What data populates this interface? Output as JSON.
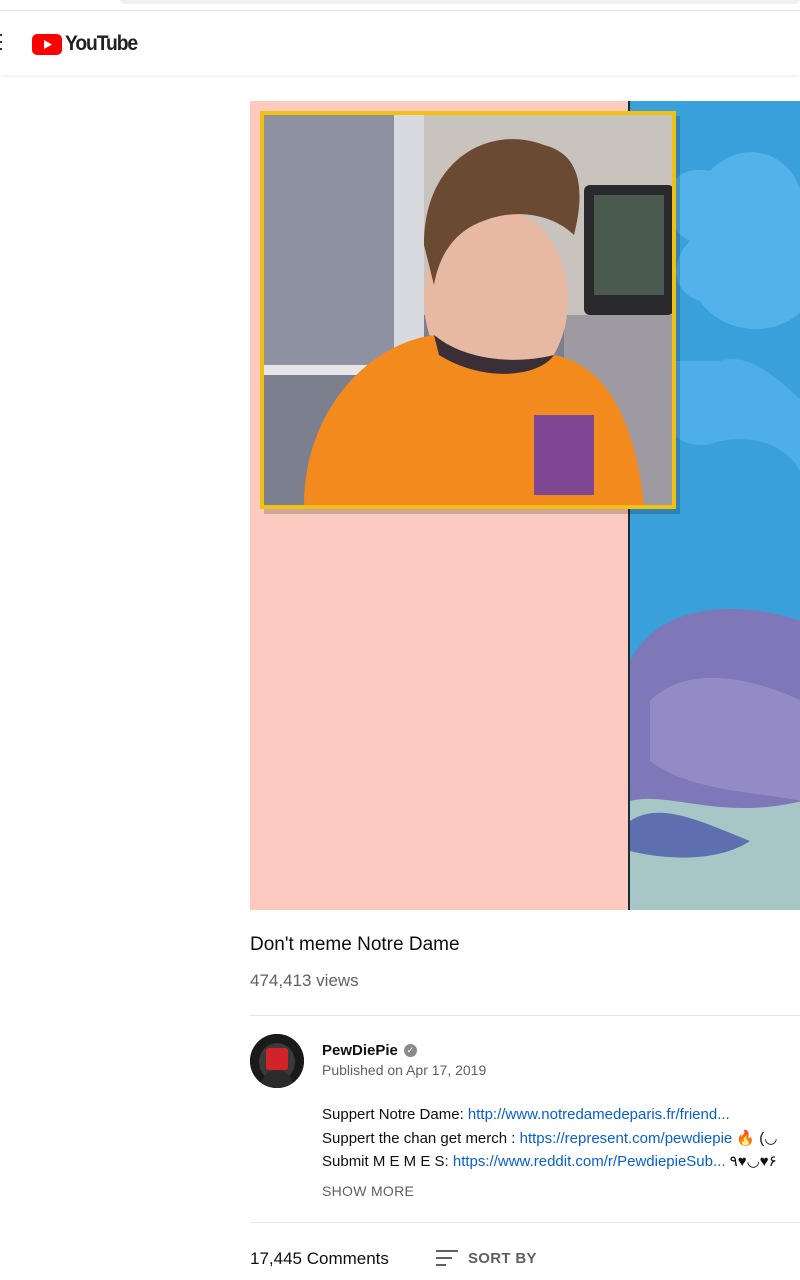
{
  "masthead": {
    "logo_text": "YouTube",
    "logo_color": "#ff0000"
  },
  "video": {
    "title": "Don't meme Notre Dame",
    "views": "474,413 views"
  },
  "channel": {
    "name": "PewDiePie",
    "verified": true,
    "published": "Published on Apr 17, 2019"
  },
  "description": {
    "lines": [
      {
        "text": "Suppert Notre Dame: ",
        "link": "http://www.notredamedeparis.fr/friend...",
        "suffix": ""
      },
      {
        "text": "Suppert the chan get merch  : ",
        "link": "https://represent.com/pewdiepie",
        "suffix": " 🔥 (◡"
      },
      {
        "text": "Submit M E M E S: ",
        "link": "https://www.reddit.com/r/PewdiepieSub...",
        "suffix": " ٩♥◡♥۶"
      }
    ],
    "show_more": "SHOW MORE"
  },
  "comments": {
    "count": "17,445 Comments",
    "sort_label": "SORT BY"
  },
  "colors": {
    "link": "#065fd4",
    "secondary_text": "#606060",
    "frame_yellow": "#f2c010",
    "bg_pink": "#fdcabf",
    "bg_blue": "#2f9ad6"
  }
}
